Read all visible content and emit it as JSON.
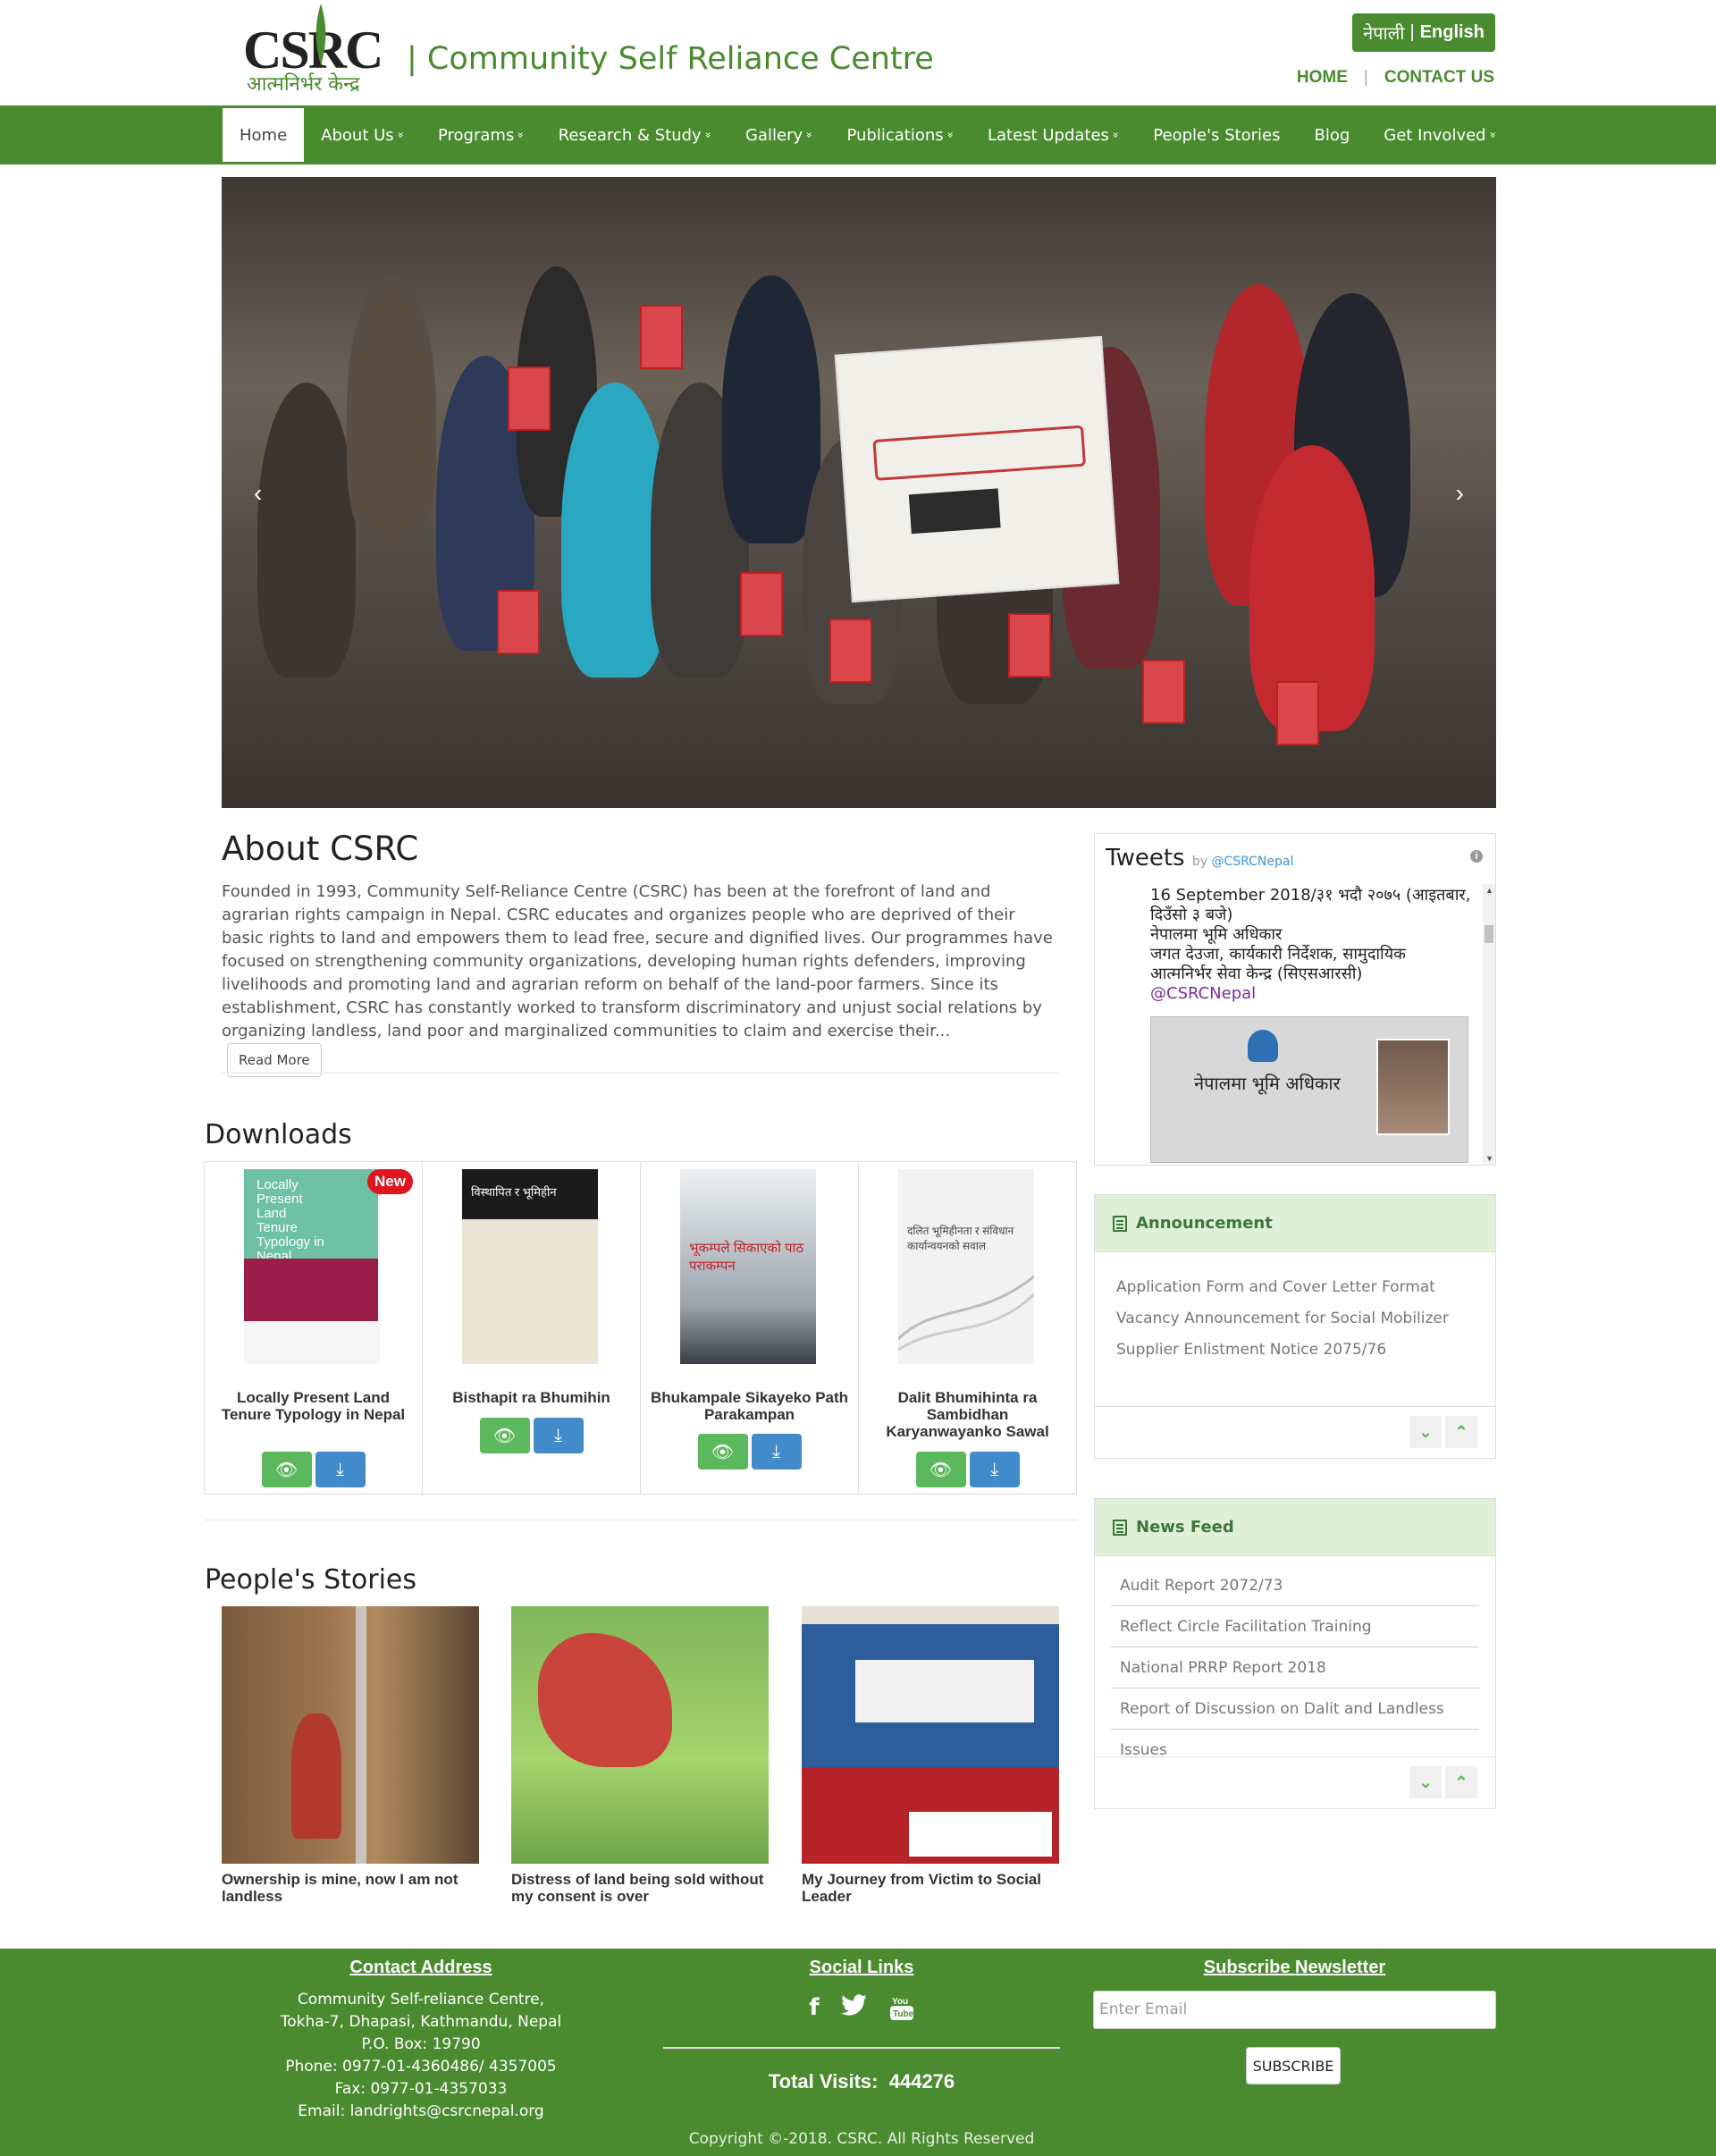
{
  "brand": {
    "logo_text": "CSRC",
    "logo_sub": "आत्मनिर्भर केन्द्र",
    "name": "| Community Self Reliance Centre"
  },
  "lang": {
    "nepali": "नेपाली",
    "sep": "|",
    "english": "English"
  },
  "toplinks": {
    "home": "HOME",
    "sep": "|",
    "contact": "CONTACT US"
  },
  "nav": {
    "items": [
      {
        "label": "Home",
        "dropdown": false
      },
      {
        "label": "About Us",
        "dropdown": true
      },
      {
        "label": "Programs",
        "dropdown": true
      },
      {
        "label": "Research & Study",
        "dropdown": true
      },
      {
        "label": "Gallery",
        "dropdown": true
      },
      {
        "label": "Publications",
        "dropdown": true
      },
      {
        "label": "Latest Updates",
        "dropdown": true
      },
      {
        "label": "People's Stories",
        "dropdown": false
      },
      {
        "label": "Blog",
        "dropdown": false
      },
      {
        "label": "Get Involved",
        "dropdown": true
      }
    ],
    "chevron": "»"
  },
  "slider": {
    "prev": "‹",
    "next": "›"
  },
  "about": {
    "title": "About CSRC",
    "text": "Founded in 1993, Community Self-Reliance Centre (CSRC) has been at the forefront of land and agrarian rights campaign in Nepal. CSRC educates and organizes people who are deprived of their basic rights to land and empowers them to lead free, secure and dignified lives. Our programmes have focused on strengthening community organizations, developing human rights defenders, improving livelihoods and promoting land and agrarian reform on behalf of the land-poor farmers. Since its establishment, CSRC has constantly worked to transform discriminatory and unjust social relations by organizing landless, land poor and marginalized communities to claim and exercise their...",
    "read_more": "Read More"
  },
  "tweets": {
    "title": "Tweets",
    "by": "by",
    "handle_link": "@CSRCNepal",
    "info": "i",
    "lines": [
      "16 September 2018/३१ भदौ २०७५ (आइतबार, दिउँसो ३ बजे)",
      "नेपालमा भूमि अधिकार",
      "जगत देउजा, कार्यकारी निर्देशक, सामुदायिक आत्मनिर्भर सेवा केन्द्र (सिएसआरसी)"
    ],
    "handle": "@CSRCNepal",
    "image_title": "नेपालमा भूमि अधिकार"
  },
  "announcement": {
    "title": "Announcement",
    "items": [
      "Application Form and Cover Letter Format",
      "Vacancy Announcement for Social Mobilizer",
      "Supplier Enlistment Notice 2075/76"
    ]
  },
  "news": {
    "title": "News Feed",
    "items": [
      "Audit Report 2072/73",
      "Reflect Circle Facilitation Training",
      "National PRRP Report 2018",
      "Report of Discussion on Dalit and Landless Issues"
    ]
  },
  "downloads": {
    "title": "Downloads",
    "badge": "New",
    "items": [
      {
        "title": "Locally Present Land Tenure Typology in Nepal",
        "cover_text": "Locally Present Land Tenure Typology in Nepal"
      },
      {
        "title": "Bisthapit ra Bhumihin",
        "cover_text": "विस्थापित र भूमिहीन"
      },
      {
        "title": "Bhukampale Sikayeko Path Parakampan",
        "cover_text": "भूकम्पले सिकाएको पाठ पराकम्पन"
      },
      {
        "title": "Dalit Bhumihinta ra Sambidhan Karyanwayanko Sawal",
        "cover_text": "दलित भूमिहीनता र संविधान कार्यान्वयनको सवाल"
      }
    ]
  },
  "stories": {
    "title": "People's Stories",
    "items": [
      {
        "caption": "Ownership is mine, now I am not landless"
      },
      {
        "caption": "Distress of land being sold without my consent is over"
      },
      {
        "caption": "My Journey from Victim to Social Leader"
      }
    ]
  },
  "footer": {
    "contact_title": "Contact Address",
    "address": [
      "Community Self-reliance Centre,",
      "Tokha-7, Dhapasi, Kathmandu, Nepal",
      "P.O. Box: 19790",
      "Phone: 0977-01-4360486/ 4357005",
      "Fax: 0977-01-4357033",
      "Email: landrights@csrcnepal.org"
    ],
    "social_title": "Social Links",
    "visits_label": "Total Visits:",
    "visits": "444276",
    "copyright": "Copyright ©-2018. CSRC. All Rights Reserved",
    "newsletter_title": "Subscribe Newsletter",
    "email_placeholder": "Enter Email",
    "subscribe": "SUBSCRIBE"
  },
  "colors": {
    "brand_green": "#4a8b2f",
    "badge_red": "#e0161e",
    "view_green": "#5cb85c",
    "download_blue": "#428bca"
  }
}
